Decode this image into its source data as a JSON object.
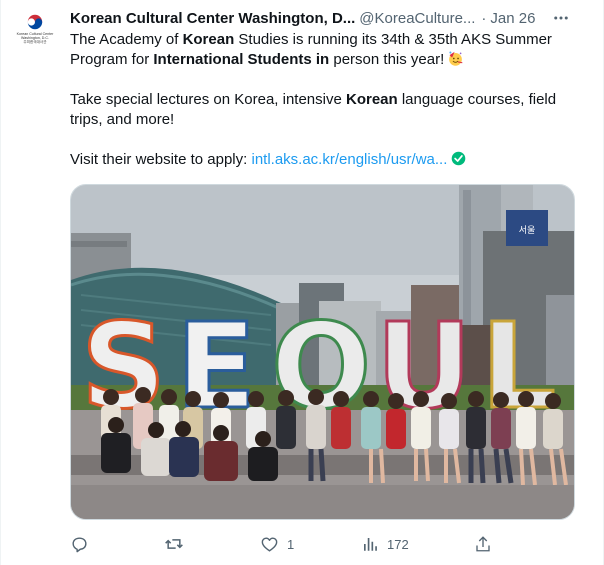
{
  "tweet": {
    "display_name": "Korean Cultural Center Washington, D...",
    "handle": "@KoreaCulture...",
    "separator": "·",
    "date": "Jan 26",
    "avatar_text_line1": "Korean Cultural Center",
    "avatar_text_line2": "Washington, D.C.",
    "avatar_text_line3": "주미한국대사관",
    "text": {
      "p1_a": "The Academy of ",
      "p1_b": "Korean",
      "p1_c": " Studies is running its 34th & 35th AKS Summer Program for ",
      "p1_d": "International Students in",
      "p1_e": " person this year!",
      "p2_a": "Take special lectures on Korea, intensive ",
      "p2_b": "Korean",
      "p2_c": " language courses, field trips, and more!",
      "p3_a": "Visit their website to apply: ",
      "p3_link": "intl.aks.ac.kr/english/usr/wa..."
    },
    "photo": {
      "sign_letters": [
        "S",
        "E",
        "O",
        "U",
        "L"
      ],
      "billboard_text": "서울"
    },
    "actions": {
      "reply_count": "",
      "retweet_count": "",
      "like_count": "1",
      "views_count": "172"
    }
  },
  "icons": {
    "more": "more-dots-icon",
    "reply": "reply-icon",
    "retweet": "retweet-icon",
    "like": "heart-icon",
    "views": "views-chart-icon",
    "share": "share-icon",
    "verified": "verified-check-icon",
    "emoji": "party-face-emoji"
  },
  "colors": {
    "link": "#1d9bf0",
    "secondary": "#536471",
    "primary_text": "#0f1419",
    "verified": "#00ba7c"
  }
}
